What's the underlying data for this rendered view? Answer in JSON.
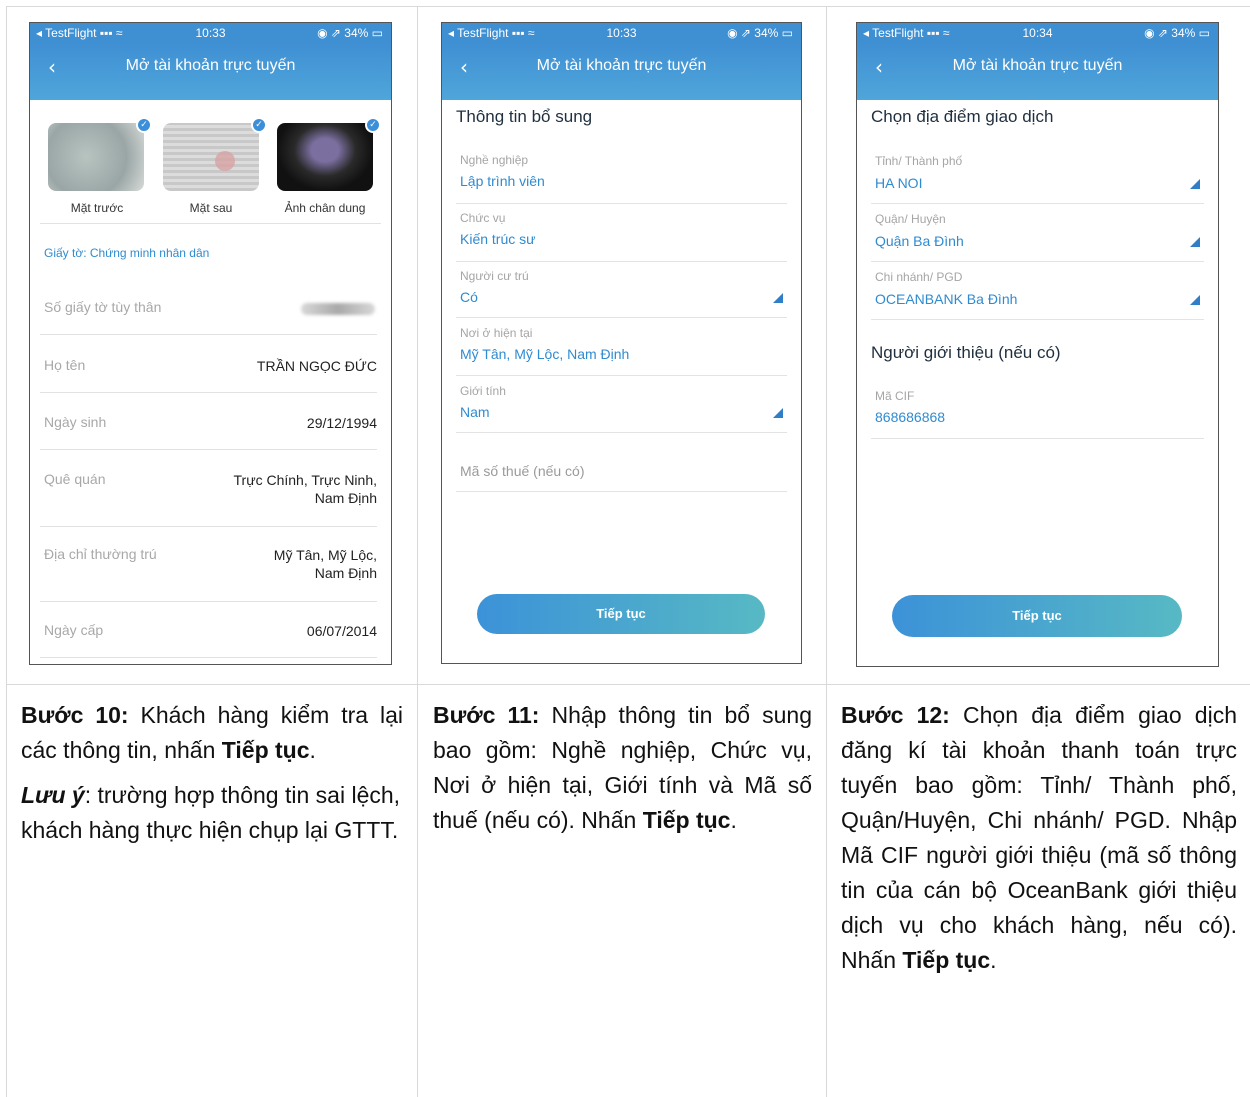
{
  "status_bar": {
    "app": "◂ TestFlight ▪▪▪ ≈",
    "battery": "◉ ⇗ 34% ▭"
  },
  "screens": [
    {
      "time": "10:33",
      "title": "Mở tài khoản trực tuyến",
      "photos": [
        "Mặt trước",
        "Mặt sau",
        "Ảnh chân dung"
      ],
      "doc_type": "Giấy tờ: Chứng minh nhân dân",
      "rows": [
        {
          "label": "Số giấy tờ tùy thân",
          "value": ""
        },
        {
          "label": "Họ tên",
          "value": "TRẦN NGỌC ĐỨC"
        },
        {
          "label": "Ngày sinh",
          "value": "29/12/1994"
        },
        {
          "label": "Quê quán",
          "value": "Trực Chính, Trực Ninh, Nam Định"
        },
        {
          "label": "Địa chỉ thường trú",
          "value": "Mỹ Tân, Mỹ Lộc, Nam Định"
        },
        {
          "label": "Ngày cấp",
          "value": "06/07/2014"
        }
      ]
    },
    {
      "time": "10:33",
      "title": "Mở tài khoản trực tuyến",
      "section": "Thông tin bổ sung",
      "fields": [
        {
          "label": "Nghề nghiệp",
          "value": "Lập trình viên"
        },
        {
          "label": "Chức vụ",
          "value": "Kiến trúc sư"
        },
        {
          "label": "Người cư trú",
          "value": "Có"
        },
        {
          "label": "Nơi ở hiện tại",
          "value": "Mỹ Tân, Mỹ Lộc, Nam Định"
        },
        {
          "label": "Giới tính",
          "value": "Nam"
        }
      ],
      "tax_placeholder": "Mã số thuế (nếu có)",
      "button": "Tiếp tục"
    },
    {
      "time": "10:34",
      "title": "Mở tài khoản trực tuyến",
      "section": "Chọn địa điểm giao dịch",
      "fields": [
        {
          "label": "Tỉnh/ Thành phố",
          "value": "HA NOI"
        },
        {
          "label": "Quận/ Huyện",
          "value": "Quận Ba Đình"
        },
        {
          "label": "Chi nhánh/ PGD",
          "value": "OCEANBANK Ba Đình"
        }
      ],
      "referrer_section": "Người giới thiệu (nếu có)",
      "cif_label": "Mã CIF",
      "cif_value": "868686868",
      "button": "Tiếp tục"
    }
  ],
  "steps": [
    {
      "label": "Bước 10:",
      "text": " Khách hàng kiểm tra lại các thông tin, nhấn ",
      "bold": "Tiếp tục",
      "end": ".",
      "note_label": "Lưu ý",
      "note_text": ": trường hợp thông tin sai lệch, khách hàng thực hiện chụp lại GTTT."
    },
    {
      "label": "Bước 11:",
      "text": " Nhập thông tin bổ sung bao gồm: Nghề nghiệp, Chức vụ, Nơi ở hiện tại, Giới tính và Mã số thuế (nếu có). Nhấn ",
      "bold": "Tiếp tục",
      "end": "."
    },
    {
      "label": "Bước 12:",
      "text": " Chọn địa điểm giao dịch đăng kí tài khoản thanh toán trực tuyến bao gồm: Tỉnh/ Thành phố, Quận/Huyện, Chi nhánh/ PGD. Nhập Mã CIF người giới thiệu (mã số thông tin của cán bộ OceanBank giới thiệu dịch vụ cho khách hàng, nếu có). Nhấn ",
      "bold": "Tiếp tục",
      "end": "."
    }
  ],
  "colors": {
    "header": "#3f8fd3",
    "accent": "#2f8bd0",
    "button_start": "#3c92d8",
    "button_end": "#57b9c4"
  }
}
